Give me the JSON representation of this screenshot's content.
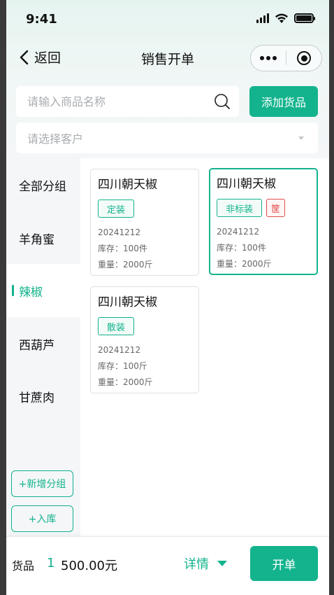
{
  "status_bar": {
    "time": "9:41"
  },
  "nav": {
    "back_label": "返回",
    "title": "销售开单"
  },
  "search": {
    "placeholder": "请输入商品名称",
    "add_button": "添加货品"
  },
  "customer": {
    "placeholder": "请选择客户"
  },
  "sidebar": {
    "items": [
      {
        "label": "全部分组",
        "active": false
      },
      {
        "label": "羊角蜜",
        "active": false
      },
      {
        "label": "辣椒",
        "active": true
      },
      {
        "label": "西葫芦",
        "active": false
      },
      {
        "label": "甘蔗肉",
        "active": false
      }
    ],
    "add_group_button": "+新增分组",
    "stock_in_button": "+入库"
  },
  "products": [
    {
      "name": "四川朝天椒",
      "tag": "定装",
      "extra_tag": "",
      "batch": "20241212",
      "stock": "库存：100件",
      "weight": "重量：2000斤",
      "selected": false
    },
    {
      "name": "四川朝天椒",
      "tag": "非标装",
      "extra_tag": "筐",
      "batch": "20241212",
      "stock": "库存：100件",
      "weight": "重量：2000斤",
      "selected": true
    },
    {
      "name": "四川朝天椒",
      "tag": "散装",
      "extra_tag": "",
      "batch": "20241212",
      "stock": "库存：100斤",
      "weight": "重量：2000斤",
      "selected": false
    }
  ],
  "bottom_bar": {
    "label": "货品",
    "count": "1",
    "amount": "500.00元",
    "detail_label": "详情",
    "open_button": "开单"
  },
  "colors": {
    "accent": "#13b38d",
    "danger": "#e04e4e"
  }
}
